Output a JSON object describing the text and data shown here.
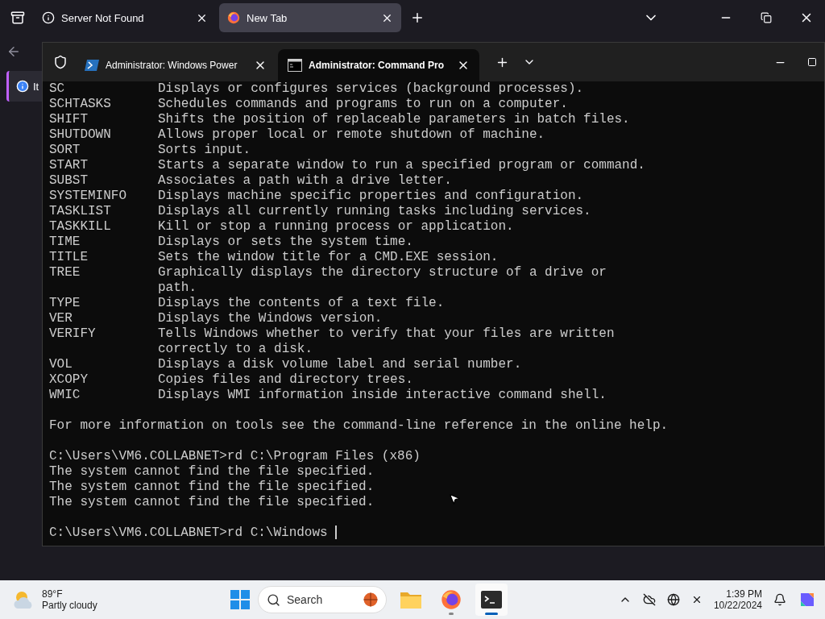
{
  "browser": {
    "tabs": [
      {
        "title": "Server Not Found",
        "selected": false
      },
      {
        "title": "New Tab",
        "selected": true
      }
    ],
    "notice": {
      "text": "It"
    }
  },
  "terminal": {
    "tabs": [
      {
        "title": "Administrator: Windows Power",
        "selected": false
      },
      {
        "title": "Administrator: Command Pro",
        "selected": true
      }
    ],
    "lines": [
      {
        "kind": "entry",
        "name": "SC",
        "description": [
          "Displays or configures services (background processes)."
        ]
      },
      {
        "kind": "entry",
        "name": "SCHTASKS",
        "description": [
          "Schedules commands and programs to run on a computer."
        ]
      },
      {
        "kind": "entry",
        "name": "SHIFT",
        "description": [
          "Shifts the position of replaceable parameters in batch files."
        ]
      },
      {
        "kind": "entry",
        "name": "SHUTDOWN",
        "description": [
          "Allows proper local or remote shutdown of machine."
        ]
      },
      {
        "kind": "entry",
        "name": "SORT",
        "description": [
          "Sorts input."
        ]
      },
      {
        "kind": "entry",
        "name": "START",
        "description": [
          "Starts a separate window to run a specified program or command."
        ]
      },
      {
        "kind": "entry",
        "name": "SUBST",
        "description": [
          "Associates a path with a drive letter."
        ]
      },
      {
        "kind": "entry",
        "name": "SYSTEMINFO",
        "description": [
          "Displays machine specific properties and configuration."
        ]
      },
      {
        "kind": "entry",
        "name": "TASKLIST",
        "description": [
          "Displays all currently running tasks including services."
        ]
      },
      {
        "kind": "entry",
        "name": "TASKKILL",
        "description": [
          "Kill or stop a running process or application."
        ]
      },
      {
        "kind": "entry",
        "name": "TIME",
        "description": [
          "Displays or sets the system time."
        ]
      },
      {
        "kind": "entry",
        "name": "TITLE",
        "description": [
          "Sets the window title for a CMD.EXE session."
        ]
      },
      {
        "kind": "entry",
        "name": "TREE",
        "description": [
          "Graphically displays the directory structure of a drive or",
          "path."
        ]
      },
      {
        "kind": "entry",
        "name": "TYPE",
        "description": [
          "Displays the contents of a text file."
        ]
      },
      {
        "kind": "entry",
        "name": "VER",
        "description": [
          "Displays the Windows version."
        ]
      },
      {
        "kind": "entry",
        "name": "VERIFY",
        "description": [
          "Tells Windows whether to verify that your files are written",
          "correctly to a disk."
        ]
      },
      {
        "kind": "entry",
        "name": "VOL",
        "description": [
          "Displays a disk volume label and serial number."
        ]
      },
      {
        "kind": "entry",
        "name": "XCOPY",
        "description": [
          "Copies files and directory trees."
        ]
      },
      {
        "kind": "entry",
        "name": "WMIC",
        "description": [
          "Displays WMI information inside interactive command shell."
        ]
      },
      {
        "kind": "gap"
      },
      {
        "kind": "text",
        "text": "For more information on tools see the command-line reference in the online help."
      },
      {
        "kind": "gap"
      },
      {
        "kind": "prompt",
        "text": "C:\\Users\\VM6.COLLABNET>rd C:\\Program Files (x86)",
        "cursor": false
      },
      {
        "kind": "text",
        "text": "The system cannot find the file specified."
      },
      {
        "kind": "text",
        "text": "The system cannot find the file specified."
      },
      {
        "kind": "text",
        "text": "The system cannot find the file specified."
      },
      {
        "kind": "gap"
      },
      {
        "kind": "prompt",
        "text": "C:\\Users\\VM6.COLLABNET>rd C:\\Windows ",
        "cursor": true
      }
    ]
  },
  "taskbar": {
    "weather": {
      "temperature": "89°F",
      "condition": "Partly cloudy"
    },
    "search": {
      "placeholder": "Search"
    },
    "apps": [
      {
        "running": false,
        "selected": false
      },
      {
        "running": true,
        "selected": false
      },
      {
        "running": true,
        "selected": true
      }
    ],
    "clock": {
      "time": "1:39 PM",
      "date": "10/22/2024"
    }
  }
}
